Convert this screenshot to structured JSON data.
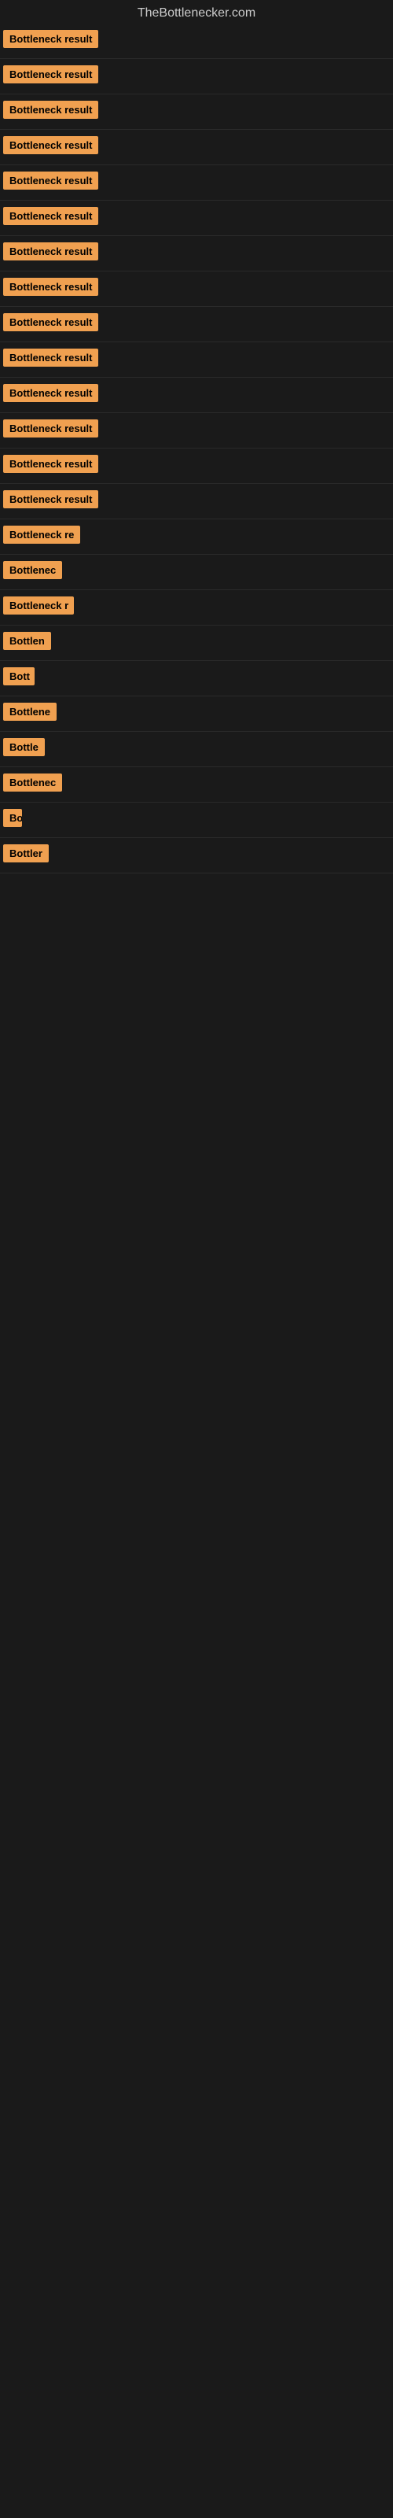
{
  "site": {
    "title": "TheBottlenecker.com"
  },
  "results": [
    {
      "label": "Bottleneck result",
      "width": 130
    },
    {
      "label": "Bottleneck result",
      "width": 130
    },
    {
      "label": "Bottleneck result",
      "width": 130
    },
    {
      "label": "Bottleneck result",
      "width": 130
    },
    {
      "label": "Bottleneck result",
      "width": 130
    },
    {
      "label": "Bottleneck result",
      "width": 130
    },
    {
      "label": "Bottleneck result",
      "width": 130
    },
    {
      "label": "Bottleneck result",
      "width": 130
    },
    {
      "label": "Bottleneck result",
      "width": 130
    },
    {
      "label": "Bottleneck result",
      "width": 130
    },
    {
      "label": "Bottleneck result",
      "width": 130
    },
    {
      "label": "Bottleneck result",
      "width": 130
    },
    {
      "label": "Bottleneck result",
      "width": 130
    },
    {
      "label": "Bottleneck result",
      "width": 130
    },
    {
      "label": "Bottleneck re",
      "width": 104
    },
    {
      "label": "Bottlenec",
      "width": 80
    },
    {
      "label": "Bottleneck r",
      "width": 90
    },
    {
      "label": "Bottlen",
      "width": 68
    },
    {
      "label": "Bott",
      "width": 40
    },
    {
      "label": "Bottlene",
      "width": 72
    },
    {
      "label": "Bottle",
      "width": 56
    },
    {
      "label": "Bottlenec",
      "width": 78
    },
    {
      "label": "Bo",
      "width": 24
    },
    {
      "label": "Bottler",
      "width": 58
    }
  ]
}
